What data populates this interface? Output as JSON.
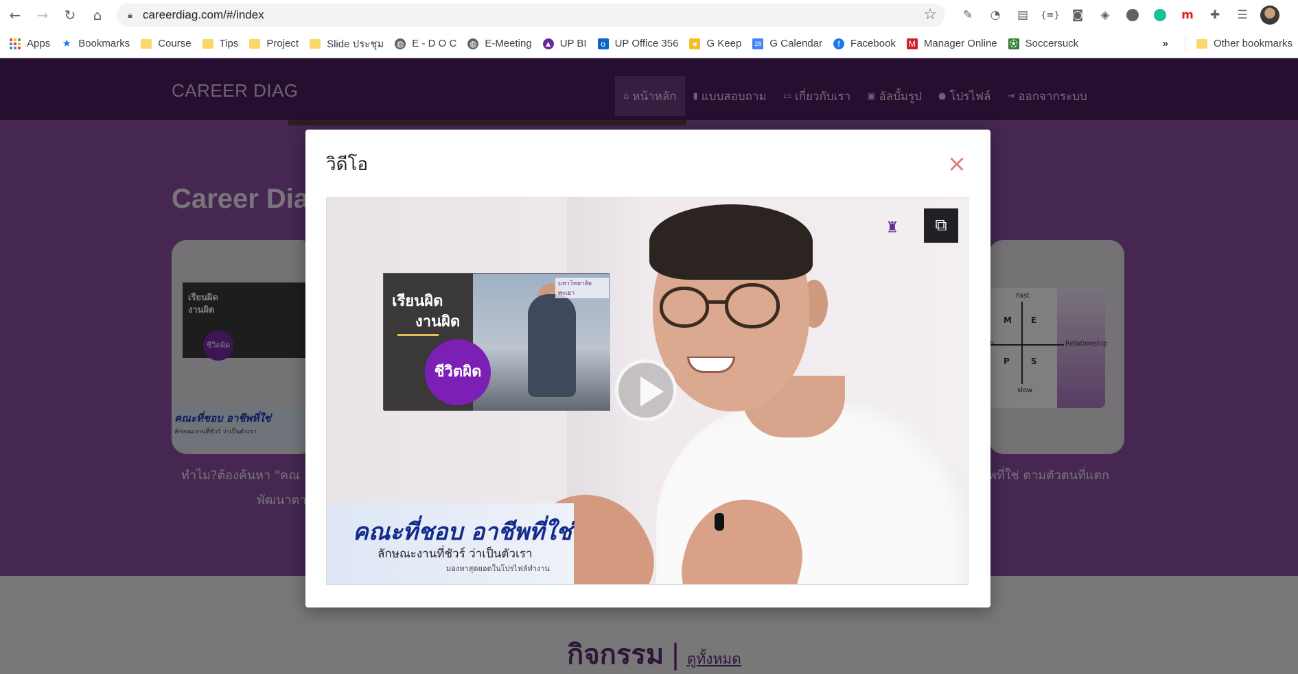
{
  "browser": {
    "url": "careerdiag.com/#/index",
    "bookmarks": [
      {
        "label": "Apps",
        "icon": "apps-grid-icon"
      },
      {
        "label": "Bookmarks",
        "icon": "star-icon"
      },
      {
        "label": "Course",
        "icon": "folder-icon"
      },
      {
        "label": "Tips",
        "icon": "folder-icon"
      },
      {
        "label": "Project",
        "icon": "folder-icon"
      },
      {
        "label": "Slide ประชุม",
        "icon": "folder-icon"
      },
      {
        "label": "E - D O C",
        "icon": "globe-icon"
      },
      {
        "label": "E-Meeting",
        "icon": "globe-icon"
      },
      {
        "label": "UP BI",
        "icon": "up-bi-icon"
      },
      {
        "label": "UP Office 356",
        "icon": "outlook-icon"
      },
      {
        "label": "G Keep",
        "icon": "keep-icon"
      },
      {
        "label": "G Calendar",
        "icon": "calendar-icon"
      },
      {
        "label": "Facebook",
        "icon": "facebook-icon"
      },
      {
        "label": "Manager Online",
        "icon": "manager-online-icon"
      },
      {
        "label": "Soccersuck",
        "icon": "soccersuck-icon"
      }
    ],
    "more_label": "»",
    "other_bookmarks": "Other bookmarks"
  },
  "site": {
    "brand": "CAREER DIAG",
    "menu": [
      {
        "label": "หน้าหลัก",
        "icon": "home-icon",
        "active": true
      },
      {
        "label": "แบบสอบถาม",
        "icon": "file-icon",
        "active": false
      },
      {
        "label": "เกี่ยวกับเรา",
        "icon": "id-card-icon",
        "active": false
      },
      {
        "label": "อัลบั้มรูป",
        "icon": "images-icon",
        "active": false
      },
      {
        "label": "โปรไฟล์",
        "icon": "user-icon",
        "active": false
      },
      {
        "label": "ออกจากระบบ",
        "icon": "sign-out-icon",
        "active": false
      }
    ],
    "hero_title": "Career Diag",
    "left_card_caption_1": "ทำไม?ต้องค้นหา \"คณ",
    "left_card_caption_2": "พัฒนาตา",
    "right_card_caption": "ีพที่ใช่ ตามตัวตนที่แตก",
    "left_thumb_line1": "เรียนผิด",
    "left_thumb_line2": "งานผิด",
    "left_thumb_circle": "ชีวิตผิด",
    "left_banner_1": "คณะที่ชอบ อาชีพที่ใช่",
    "left_banner_2": "ลักษณะงานที่ชัวร์ ว่าเป็นตัวเรา",
    "diagram": {
      "fast": "Fast",
      "slow": "slow",
      "relationship": "Relationship",
      "m": "M",
      "e": "E",
      "p": "P",
      "s": "S",
      "b": "b"
    },
    "activities_title": "กิจกรรม",
    "activities_sep": "|",
    "activities_all": "ดูทั้งหมด"
  },
  "modal": {
    "title": "วิดีโอ",
    "close_glyph": "×",
    "video": {
      "poster_line1": "เรียนผิด",
      "poster_line2": "งานผิด",
      "poster_circle": "ชีวิตผิด",
      "poster_logo": "มหาวิทยาลัยพะเยา",
      "banner_title_a": "คณะที่ชอบ",
      "banner_title_b": " อาชีพที่ใช่",
      "banner_sub": "ลักษณะงานที่ชัวร์ ว่าเป็นตัวเรา",
      "banner_small": "มองหาสุดยอดในโปรไฟล์ทำงาน",
      "open_external_glyph": "⧉"
    }
  },
  "colors": {
    "header_bg": "#4a1c5e",
    "hero_bg": "#8a4ea3",
    "accent_purple": "#7b1fb5",
    "close_color": "#e07a7a"
  }
}
